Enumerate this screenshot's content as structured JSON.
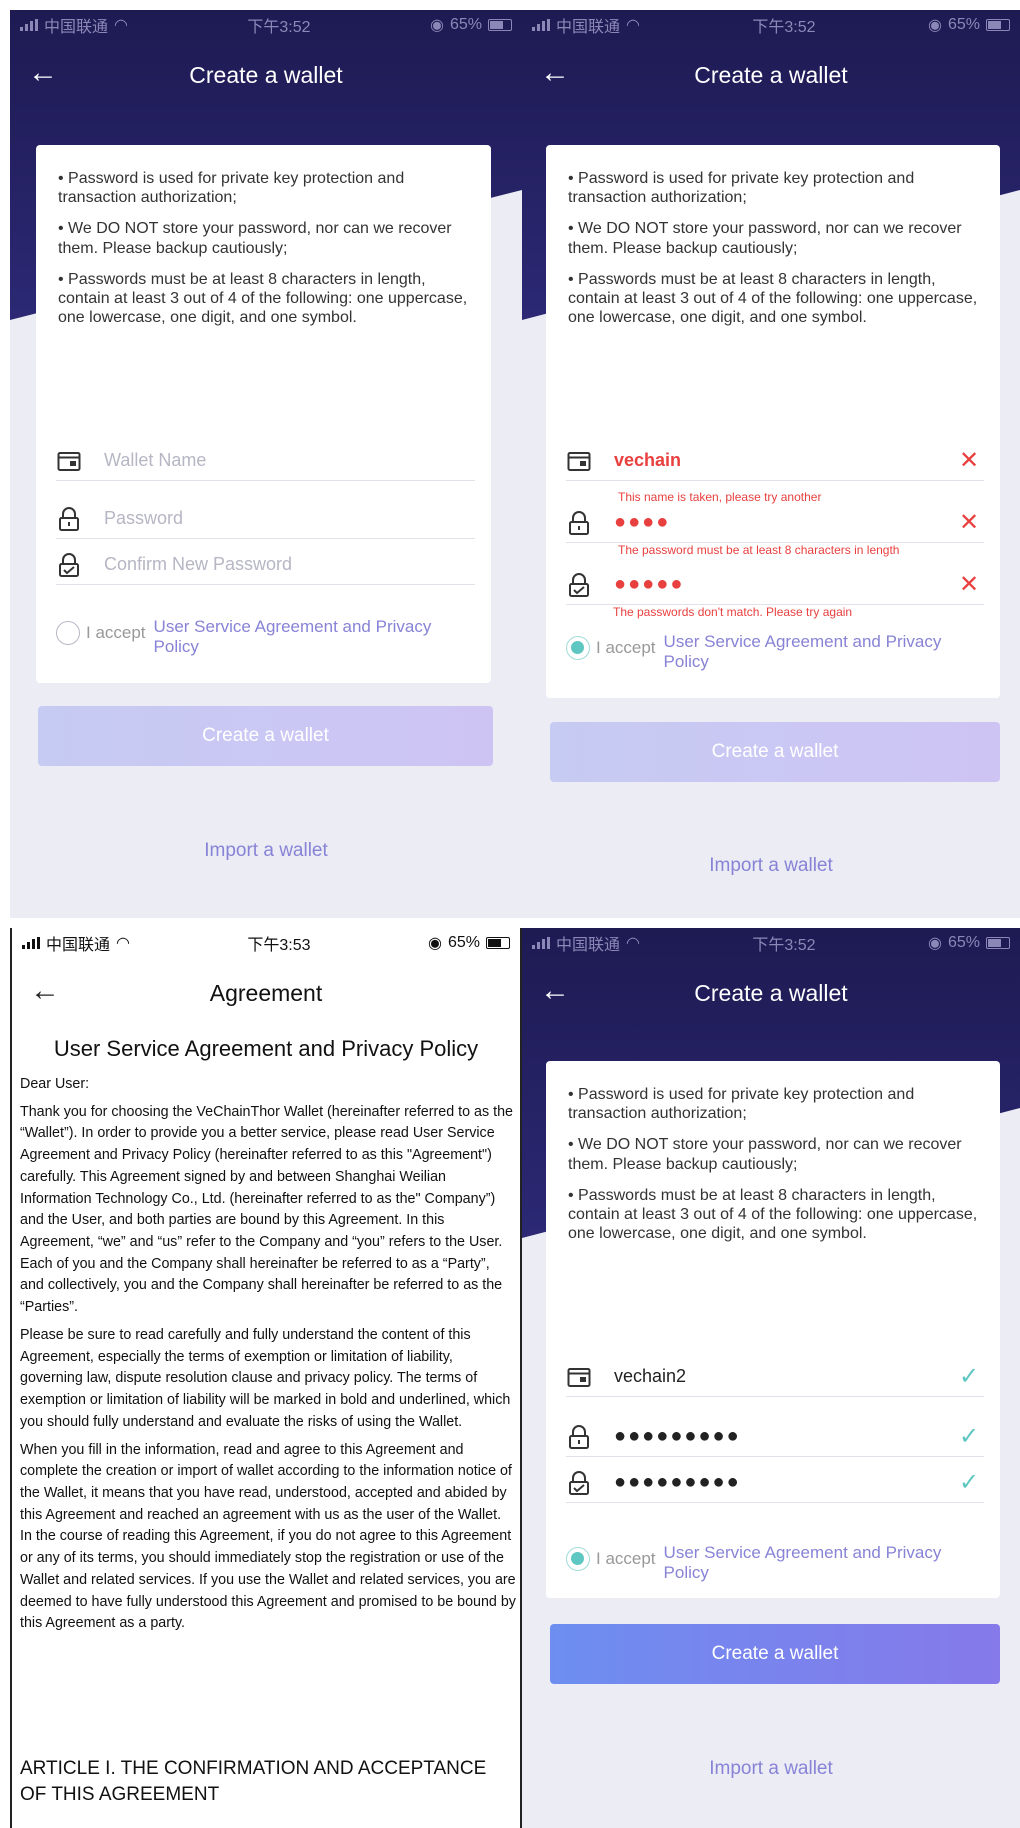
{
  "status_top_left": {
    "carrier": "中国联通",
    "time": "下午3:52",
    "battery": "65%"
  },
  "status_top_right": {
    "carrier": "中国联通",
    "time": "下午3:52",
    "battery": "65%"
  },
  "status_bottom_left": {
    "carrier": "中国联通",
    "time": "下午3:53",
    "battery": "65%"
  },
  "status_bottom_right": {
    "carrier": "中国联通",
    "time": "下午3:52",
    "battery": "65%"
  },
  "create_title": "Create a wallet",
  "agreement_nav_title": "Agreement",
  "bullets": [
    "• Password is used for private key protection and transaction authorization;",
    "• We DO NOT store your password, nor can we recover them. Please backup cautiously;",
    "• Passwords must be at least 8 characters in length, contain at least 3 out of 4 of the following: one uppercase, one lowercase, one digit, and one symbol."
  ],
  "placeholders": {
    "wallet_name": "Wallet Name",
    "password": "Password",
    "confirm": "Confirm New Password"
  },
  "error_state": {
    "wallet_name": "vechain",
    "name_error": "This name is taken, please try another",
    "password_dots": "●●●●",
    "password_error": "The password must be at least 8 characters in length",
    "confirm_dots": "●●●●●",
    "confirm_error": "The passwords don't match. Please try again"
  },
  "valid_state": {
    "wallet_name": "vechain2",
    "password_dots": "●●●●●●●●●",
    "confirm_dots": "●●●●●●●●●"
  },
  "accept_label": "I accept",
  "agreement_link": "User Service Agreement and Privacy Policy",
  "create_button": "Create a wallet",
  "import_link": "Import a wallet",
  "agreement": {
    "heading": "User Service Agreement and Privacy Policy",
    "salutation": "Dear User:",
    "p1": "Thank you for choosing the VeChainThor Wallet (hereinafter referred to as the “Wallet”). In order to provide you a better service, please read User Service Agreement and Privacy Policy (hereinafter referred to as this \"Agreement\") carefully. This Agreement signed by and between Shanghai Weilian Information Technology Co., Ltd. (hereinafter referred to as the\" Company”) and the User, and both parties are bound by this Agreement. In this Agreement, “we” and “us” refer to the Company and “you” refers to the User. Each of you and the Company shall hereinafter be referred to as a “Party”, and collectively, you and the Company shall hereinafter be referred to as the “Parties”.",
    "p2": "Please be sure to read carefully and fully understand the content of this Agreement, especially the terms of exemption or limitation of liability, governing law, dispute resolution clause and privacy policy. The terms of exemption or limitation of liability will be marked in bold and underlined, which you should fully understand and evaluate the risks of using the Wallet.",
    "p3": "When you fill in the information, read and agree to this Agreement and complete the creation or import of wallet according to the information notice of the Wallet, it means that you have read, understood, accepted and abided by this Agreement and reached an agreement with us as the user of the Wallet. In the course of reading this Agreement, if you do not agree to this Agreement or any of its terms, you should immediately stop the registration or use of the Wallet and related services. If you use the Wallet and related services, you are deemed to have fully understood this Agreement and promised to be bound by this Agreement as a party.",
    "article": "ARTICLE I. THE CONFIRMATION AND ACCEPTANCE OF THIS AGREEMENT"
  }
}
